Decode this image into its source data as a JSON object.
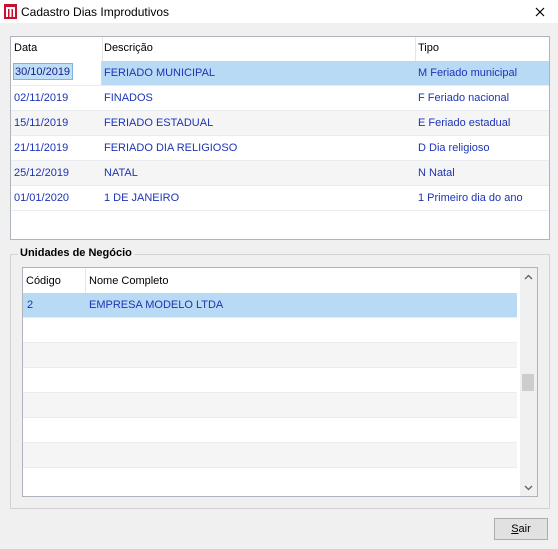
{
  "window": {
    "title": "Cadastro Dias Improdutivos",
    "close_icon": "close-icon",
    "app_icon": "app-logo-icon"
  },
  "holidays": {
    "columns": [
      "Data",
      "Descrição",
      "Tipo"
    ],
    "rows": [
      {
        "data": "30/10/2019",
        "descricao": "FERIADO MUNICIPAL",
        "tipo": "M Feriado municipal"
      },
      {
        "data": "02/11/2019",
        "descricao": "FINADOS",
        "tipo": "F Feriado nacional"
      },
      {
        "data": "15/11/2019",
        "descricao": "FERIADO ESTADUAL",
        "tipo": "E Feriado estadual"
      },
      {
        "data": "21/11/2019",
        "descricao": "FERIADO DIA RELIGIOSO",
        "tipo": "D Dia religioso"
      },
      {
        "data": "25/12/2019",
        "descricao": "NATAL",
        "tipo": "N Natal"
      },
      {
        "data": "01/01/2020",
        "descricao": "1 DE JANEIRO",
        "tipo": "1 Primeiro dia do ano"
      }
    ],
    "selected_row": 0
  },
  "business_units": {
    "group_label": "Unidades de Negócio",
    "columns": [
      "Código",
      "Nome Completo"
    ],
    "rows": [
      {
        "codigo": "2",
        "nome": "EMPRESA MODELO LTDA"
      }
    ],
    "selected_row": 0
  },
  "footer": {
    "sair_prefix": "S",
    "sair_rest": "air"
  },
  "colors": {
    "selection": "#b9daf5",
    "cell_text": "#1d34b5",
    "window_bg": "#f0f0f0"
  }
}
